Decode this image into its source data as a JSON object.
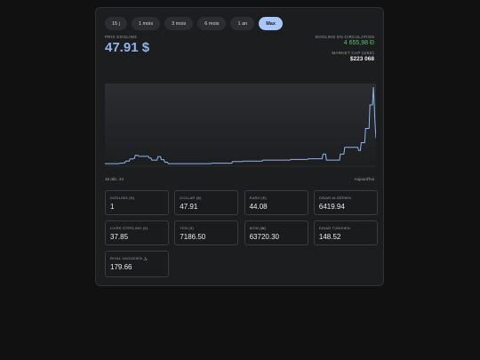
{
  "tabs": [
    {
      "label": "15 j",
      "active": false
    },
    {
      "label": "1 mois",
      "active": false
    },
    {
      "label": "3 mois",
      "active": false
    },
    {
      "label": "6 mois",
      "active": false
    },
    {
      "label": "1 an",
      "active": false
    },
    {
      "label": "Max",
      "active": true
    }
  ],
  "price": {
    "label": "PRIX DOGLING",
    "value": "47.91 $"
  },
  "circulation": {
    "label": "DOGLING EN CIRCULATION",
    "value": "4 655,98 Ð"
  },
  "market_cap": {
    "label": "MARKET CAP (USD)",
    "value": "$223 068"
  },
  "colors": {
    "accent": "#a9c7f8",
    "price": "#8fb4ef",
    "green": "#5cc26a",
    "line": "#8fb4ef"
  },
  "chart_data": {
    "type": "line",
    "x_range": [
      "15 déc. 24",
      "Aujourd'hui"
    ],
    "grid": false,
    "series": [
      {
        "values": [
          1,
          1,
          1,
          1,
          1,
          1,
          1,
          1,
          1,
          1,
          1,
          1,
          1,
          1,
          1,
          1,
          1,
          1.3,
          1.3,
          1.3,
          1.3,
          1.5,
          1.5,
          1.5,
          2.6,
          2.6,
          2.6,
          2.6,
          2.6,
          3.9,
          3.9,
          3.9,
          3.9,
          4.2,
          4.2,
          6.1,
          6.1,
          6.1,
          6.1,
          5.5,
          5.5,
          5.5,
          5.5,
          5.5,
          5.5,
          5.5,
          5.5,
          5.5,
          5.5,
          5.5,
          5.5,
          4.5,
          4.5,
          4.5,
          3.2,
          3.2,
          3.2,
          3.2,
          3.2,
          3.2,
          3.2,
          5.3,
          5.3,
          5.3,
          5.3,
          3.5,
          3.5,
          3.5,
          3.5,
          1.9,
          1.9,
          1.9,
          1.9,
          1,
          1,
          1,
          1,
          1,
          1,
          1,
          1,
          1,
          1,
          1,
          1,
          1,
          1,
          1,
          1,
          1,
          1,
          1,
          1,
          1,
          1,
          1,
          1,
          1,
          1,
          1,
          1,
          1,
          1,
          1,
          1,
          1,
          1,
          1,
          1,
          1,
          1,
          1,
          1,
          1,
          1,
          1,
          1,
          1,
          1,
          1,
          1,
          1,
          1,
          1.3,
          1.3,
          1.3,
          1.3,
          1.3,
          1.3,
          1.3,
          1.3,
          1.3,
          1.3,
          1.3,
          1.3,
          1.3,
          1.3,
          1.3,
          1.3,
          1.3,
          1.3,
          1.3,
          1.3,
          1.3,
          1.3,
          1.3,
          1.3,
          2.3,
          2.3,
          2.3,
          2.3,
          2.3,
          2.3,
          2.3,
          2.3,
          2.3,
          2.3,
          2.3,
          2.3,
          2.6,
          2.6,
          2.6,
          2.6,
          2.6,
          2.6,
          2.6,
          2.6,
          2.6,
          2.6,
          2.6,
          2.6,
          2.6,
          2.6,
          2.6,
          2.6,
          2.6,
          2.6,
          2.6,
          2.6,
          2.6,
          2.6,
          2.6,
          3.2,
          3.2,
          3.2,
          3.2,
          3.2,
          3.2,
          3.2,
          3.2,
          3.2,
          3.2,
          3.2,
          3.2,
          3.2,
          3.2,
          3.2,
          3.2,
          3.2,
          3.2,
          3.2,
          3.2,
          3.2,
          3.2,
          3.2,
          3.2,
          3.2,
          3.2,
          3.2,
          3.2,
          3.2,
          3.2,
          3.2,
          3.2,
          3.6,
          3.6,
          3.6,
          3.6,
          3.6,
          3.6,
          3.6,
          3.6,
          3.6,
          3.6,
          3.6,
          3.6,
          3.6,
          3.6,
          3.6,
          3.6,
          3.6,
          3.6,
          3.6,
          3.6,
          4,
          4,
          4,
          4,
          4,
          4,
          4,
          4,
          4,
          4,
          4,
          4,
          4,
          4,
          4,
          4,
          4,
          6.9,
          6.9,
          6.9,
          6.9,
          3.2,
          3.2,
          3.2,
          3.2,
          3.2,
          3.2,
          3.2,
          3.2,
          3.2,
          3.2,
          3.2,
          3.2,
          3.2,
          3.2,
          3.2,
          3.2,
          6.9,
          6.9,
          6.9,
          6.9,
          6.9,
          11,
          11,
          11,
          11,
          11,
          11,
          11,
          11,
          11,
          11,
          11,
          11,
          11,
          11,
          11,
          11,
          9.1,
          9.1,
          9.1,
          13.9,
          13.9,
          13.9,
          13.9,
          13.9,
          22.6,
          22.6,
          22.6,
          22.6,
          22.6,
          37,
          37,
          37,
          37,
          47.91,
          37,
          24.3,
          16.6
        ]
      }
    ]
  },
  "dates": {
    "start": "15 déc. 24",
    "end": "Aujourd'hui"
  },
  "rates": [
    {
      "label": "DOGLING (Ð)",
      "value": "1"
    },
    {
      "label": "DOLLAR ($)",
      "value": "47.91"
    },
    {
      "label": "EURO (€)",
      "value": "44.08"
    },
    {
      "label": "DINAR ALGÉRIEN",
      "value": "6419.94"
    },
    {
      "label": "LIVRE STERLING (£)",
      "value": "37.85"
    },
    {
      "label": "YEN (¥)",
      "value": "7186.50"
    },
    {
      "label": "WON (₩)",
      "value": "63720.30"
    },
    {
      "label": "DINAR TUNISIEN",
      "value": "148.52"
    },
    {
      "label": "RIYAL SAOUDIEN ﷼",
      "value": "179.66"
    }
  ]
}
